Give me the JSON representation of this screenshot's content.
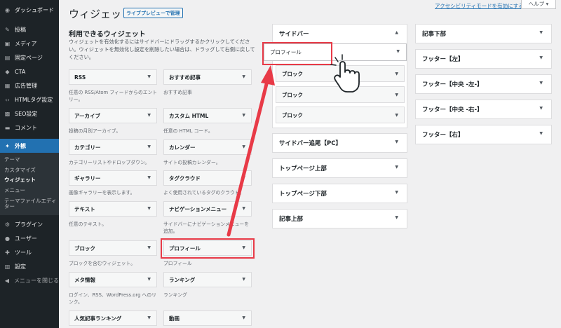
{
  "admin_menu": {
    "items": [
      {
        "label": "ダッシュボード",
        "icon": "dashboard-icon",
        "glyph": "◉"
      },
      {
        "label": "投稿",
        "icon": "pin-icon",
        "glyph": "✎"
      },
      {
        "label": "メディア",
        "icon": "media-icon",
        "glyph": "▣"
      },
      {
        "label": "固定ページ",
        "icon": "page-icon",
        "glyph": "▤"
      },
      {
        "label": "CTA",
        "icon": "megaphone-icon",
        "glyph": "◆"
      },
      {
        "label": "広告管理",
        "icon": "ads-icon",
        "glyph": "▦"
      },
      {
        "label": "HTMLタグ設定",
        "icon": "code-icon",
        "glyph": "‹›"
      },
      {
        "label": "SEO設定",
        "icon": "seo-icon",
        "glyph": "▩"
      },
      {
        "label": "コメント",
        "icon": "comment-icon",
        "glyph": "▬"
      },
      {
        "label": "外観",
        "icon": "appearance-icon",
        "glyph": "✦"
      },
      {
        "label": "プラグイン",
        "icon": "plugin-icon",
        "glyph": "⚙"
      },
      {
        "label": "ユーザー",
        "icon": "user-icon",
        "glyph": "●"
      },
      {
        "label": "ツール",
        "icon": "tools-icon",
        "glyph": "✚"
      },
      {
        "label": "設定",
        "icon": "settings-icon",
        "glyph": "▥"
      },
      {
        "label": "メニューを閉じる",
        "icon": "collapse-icon",
        "glyph": "◀"
      }
    ],
    "submenu": [
      "テーマ",
      "カスタマイズ",
      "ウィジェット",
      "メニュー",
      "テーマファイルエディター"
    ]
  },
  "header": {
    "title": "ウィジェット",
    "live_preview": "ライブプレビューで管理",
    "accessibility_link": "アクセシビリティモードを有効にする",
    "help": "ヘルプ ▾"
  },
  "available": {
    "title": "利用できるウィジェット",
    "description": "ウィジェットを有効化するにはサイドバーにドラッグするかクリックしてください。ウィジェットを無効化し設定を削除したい場合は、ドラッグして右側に戻してください。",
    "widgets": [
      {
        "name": "RSS",
        "desc": "任意の RSS/Atom フィードからのエントリー。"
      },
      {
        "name": "おすすめ記事",
        "desc": "おすすめ記事"
      },
      {
        "name": "アーカイブ",
        "desc": "投稿の月別アーカイブ。"
      },
      {
        "name": "カスタム HTML",
        "desc": "任意の HTML コード。"
      },
      {
        "name": "カテゴリー",
        "desc": "カテゴリーリストやドロップダウン。"
      },
      {
        "name": "カレンダー",
        "desc": "サイトの投稿カレンダー。"
      },
      {
        "name": "ギャラリー",
        "desc": "画像ギャラリーを表示します。"
      },
      {
        "name": "タグクラウド",
        "desc": "よく使用されているタグのクラウド。"
      },
      {
        "name": "テキスト",
        "desc": "任意のテキスト。"
      },
      {
        "name": "ナビゲーションメニュー",
        "desc": "サイドバーにナビゲーションメニューを追加。"
      },
      {
        "name": "ブロック",
        "desc": "ブロックを含むウィジェット。"
      },
      {
        "name": "プロフィール",
        "desc": "プロフィール"
      },
      {
        "name": "メタ情報",
        "desc": "ログイン、RSS、WordPress.org へのリンク。"
      },
      {
        "name": "ランキング",
        "desc": "ランキング"
      },
      {
        "name": "人気記事ランキング",
        "desc": ""
      },
      {
        "name": "動画",
        "desc": ""
      }
    ]
  },
  "sidebar_area": {
    "title": "サイドバー",
    "dragging": "プロフィール",
    "widgets": [
      "ブロック",
      "ブロック",
      "ブロック"
    ]
  },
  "mid_areas": [
    "サイドバー追尾【PC】",
    "トップページ上部",
    "トップページ下部",
    "記事上部"
  ],
  "right_areas": [
    "記事下部",
    "フッター【左】",
    "フッター【中央 -左-】",
    "フッター【中央 -右-】",
    "フッター【右】"
  ],
  "colors": {
    "highlight": "#e83a47",
    "accent": "#2271b1",
    "admin_bg": "#1d2327"
  }
}
